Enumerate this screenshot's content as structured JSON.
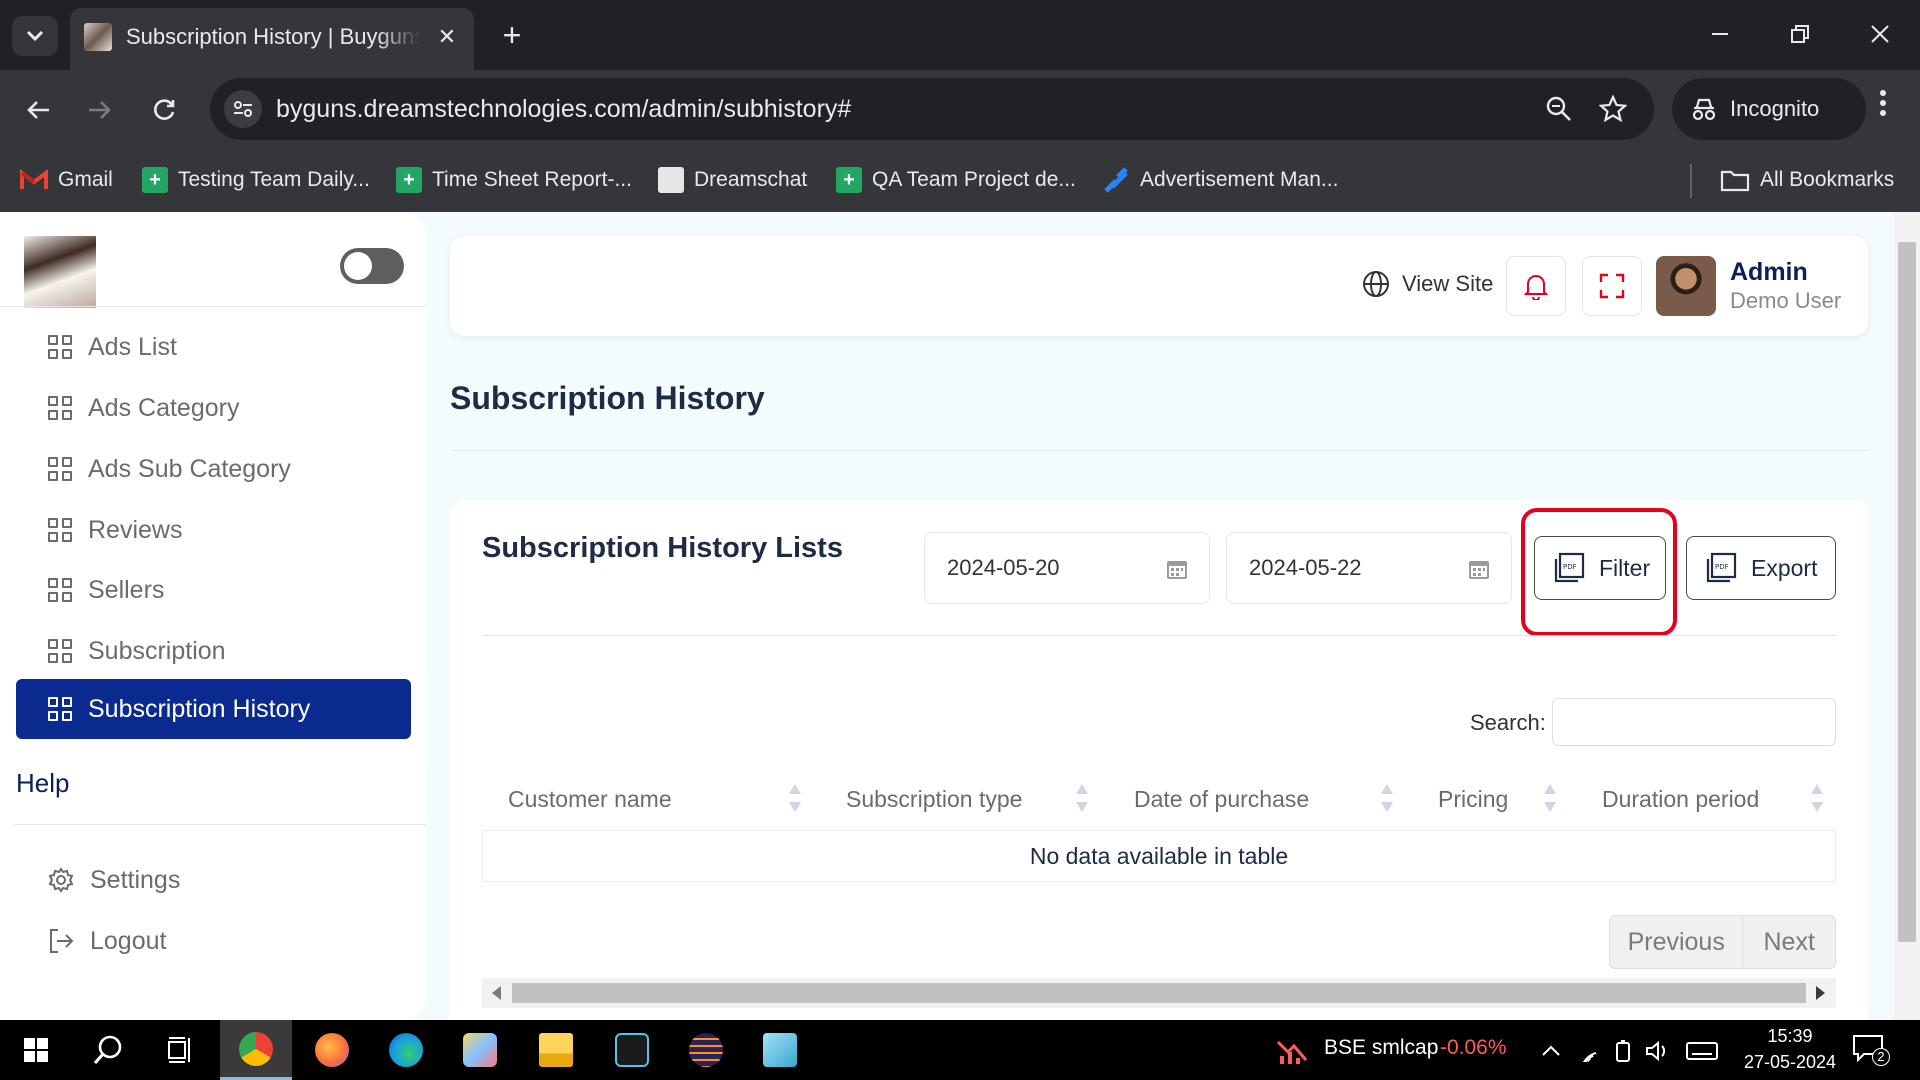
{
  "browser": {
    "tab_title": "Subscription History | Buygunsgun",
    "tab_close": "✕",
    "new_tab": "+",
    "url": "byguns.dreamstechnologies.com/admin/subhistory#",
    "incognito_label": "Incognito",
    "bookmarks": [
      {
        "label": "Gmail",
        "icon": "gmail-icon"
      },
      {
        "label": "Testing Team Daily...",
        "icon": "sheets-icon"
      },
      {
        "label": "Time Sheet Report-...",
        "icon": "sheets-icon"
      },
      {
        "label": "Dreamschat",
        "icon": "dreamschat-icon"
      },
      {
        "label": "QA Team Project de...",
        "icon": "sheets-icon"
      },
      {
        "label": "Advertisement Man...",
        "icon": "jira-icon"
      }
    ],
    "all_bookmarks_label": "All Bookmarks"
  },
  "sidebar": {
    "items": [
      {
        "label": "Ads List",
        "active": false
      },
      {
        "label": "Ads Category",
        "active": false
      },
      {
        "label": "Ads Sub Category",
        "active": false
      },
      {
        "label": "Reviews",
        "active": false
      },
      {
        "label": "Sellers",
        "active": false
      },
      {
        "label": "Subscription",
        "active": false
      },
      {
        "label": "Subscription History",
        "active": true
      }
    ],
    "help_label": "Help",
    "settings_label": "Settings",
    "logout_label": "Logout",
    "active_color": "#0a2a8f"
  },
  "header": {
    "view_site_label": "View Site",
    "user_name": "Admin",
    "user_role": "Demo User"
  },
  "main": {
    "page_title": "Subscription History",
    "card_title": "Subscription History Lists",
    "date_from": "2024-05-20",
    "date_to": "2024-05-22",
    "filter_label": "Filter",
    "export_label": "Export",
    "search_label": "Search:",
    "search_value": "",
    "columns": [
      "Customer name",
      "Subscription type",
      "Date of purchase",
      "Pricing",
      "Duration period"
    ],
    "empty_message": "No data available in table",
    "prev_label": "Previous",
    "next_label": "Next",
    "highlight_color": "#e5001f"
  },
  "taskbar": {
    "stock_name": "BSE smlcap",
    "stock_change": "-0.06%",
    "time": "15:39",
    "date": "27-05-2024",
    "notification_count": "2"
  }
}
